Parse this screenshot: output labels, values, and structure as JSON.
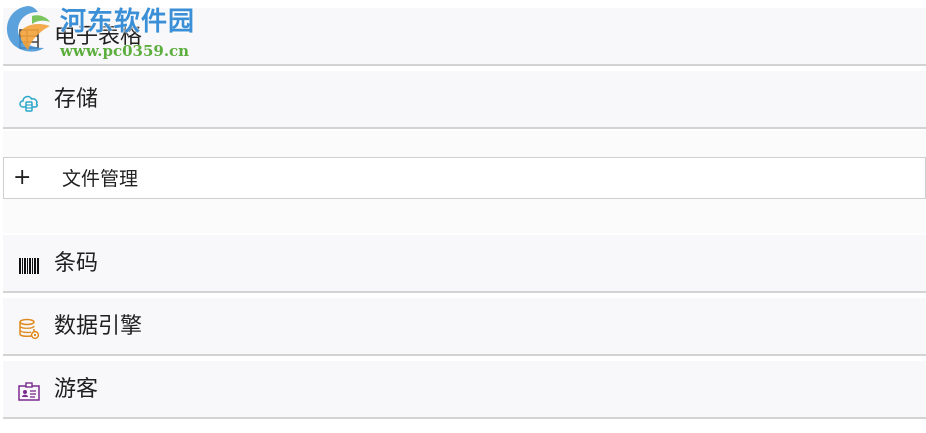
{
  "panels": {
    "spreadsheet": {
      "label": "电子表格",
      "icon": "spreadsheet-icon"
    },
    "storage": {
      "label": "存储",
      "icon": "cloud-storage-icon"
    },
    "barcode": {
      "label": "条码",
      "icon": "barcode-icon"
    },
    "data_engine": {
      "label": "数据引擎",
      "icon": "database-gear-icon"
    },
    "guest": {
      "label": "游客",
      "icon": "id-card-icon"
    }
  },
  "file_management": {
    "expand_symbol": "+",
    "label": "文件管理"
  },
  "watermark": {
    "title": "河东软件园",
    "url": "www.pc0359.cn"
  },
  "colors": {
    "storage_icon": "#2aa6c9",
    "engine_icon": "#e08a1e",
    "guest_icon": "#7a2c8f",
    "watermark_title": "#3a8fd6",
    "watermark_url": "#5cae3e"
  }
}
